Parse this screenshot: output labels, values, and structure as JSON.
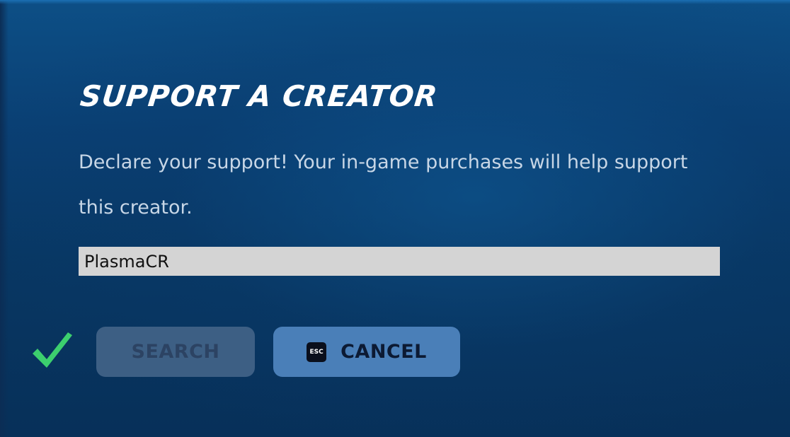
{
  "dialog": {
    "title": "SUPPORT A CREATOR",
    "description": "Declare your support! Your in-game purchases will help support this creator."
  },
  "creator_input": {
    "value": "PlasmaCR"
  },
  "actions": {
    "confirm_icon": "checkmark-icon",
    "search_label": "SEARCH",
    "cancel_label": "CANCEL",
    "cancel_key_icon": "esc-key-icon",
    "cancel_key_text": "ESC"
  },
  "colors": {
    "background": "#0a3f73",
    "title": "#ffffff",
    "description": "#c7d6e6",
    "input_bg": "#d4d4d4",
    "search_button_bg": "#3d5f84",
    "cancel_button_bg": "#4a7fb8",
    "checkmark": "#3ccf6e"
  }
}
